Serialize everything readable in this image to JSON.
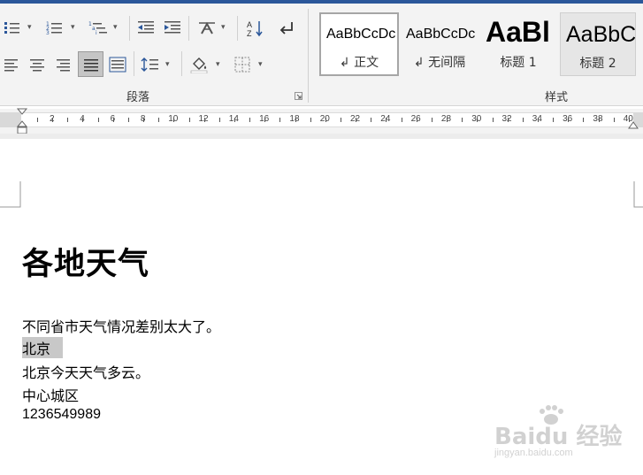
{
  "ribbon": {
    "paragraph_group_label": "段落",
    "styles_group_label": "样式",
    "styles": [
      {
        "preview": "AaBbCcDc",
        "name": "↲ 正文"
      },
      {
        "preview": "AaBbCcDc",
        "name": "↲ 无间隔"
      },
      {
        "preview": "AaBl",
        "name": "标题 1"
      },
      {
        "preview": "AaBbC",
        "name": "标题 2"
      }
    ]
  },
  "ruler": {
    "numbers": [
      "2",
      "4",
      "6",
      "8",
      "10",
      "12",
      "14",
      "16",
      "18",
      "20",
      "22",
      "24",
      "26",
      "28",
      "30",
      "32",
      "34",
      "36",
      "38",
      "40"
    ]
  },
  "document": {
    "heading": "各地天气",
    "lines": [
      "不同省市天气情况差别太大了。",
      "北京",
      "北京今天天气多云。",
      "中心城区",
      "1236549989"
    ]
  },
  "watermark": {
    "brand": "Bai",
    "brand_suffix": "du 经验",
    "url": "jingyan.baidu.com"
  },
  "colors": {
    "accent": "#2b579a",
    "selection": "#c8c8c8",
    "ribbon_bg": "#f3f3f3"
  }
}
